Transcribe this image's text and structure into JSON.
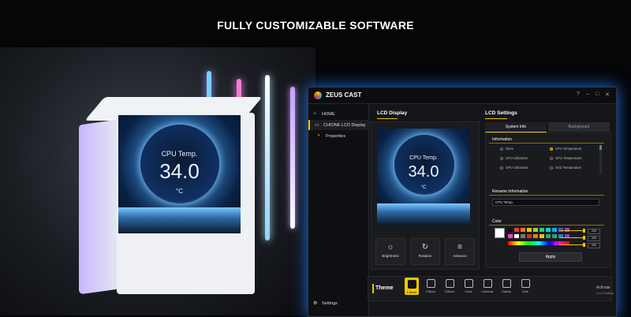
{
  "headline": "FULLY CUSTOMIZABLE SOFTWARE",
  "device_screen": {
    "title": "CPU Temp.",
    "value": "34.0",
    "unit": "°C"
  },
  "app": {
    "name": "ZEUS CAST",
    "window_controls": [
      "?",
      "–",
      "□",
      "✕"
    ],
    "sidebar": {
      "items": [
        {
          "label": "HOME",
          "icon": "home-icon"
        },
        {
          "label": "CHIONE LCD Display",
          "icon": "monitor-icon",
          "active": true
        },
        {
          "label": "Properties",
          "icon": "folder-icon"
        }
      ],
      "settings_label": "Settings"
    },
    "lcd_display": {
      "title": "LCD Display",
      "preview": {
        "title": "CPU Temp.",
        "value": "34.0",
        "unit": "°C"
      },
      "controls": [
        {
          "label": "Brightness",
          "icon": "☼"
        },
        {
          "label": "Rotation",
          "icon": "↻"
        },
        {
          "label": "Advance",
          "icon": "≡"
        }
      ]
    },
    "lcd_settings": {
      "title": "LCD Settings",
      "tabs": [
        {
          "label": "System Info",
          "active": true
        },
        {
          "label": "Background",
          "active": false
        }
      ],
      "information": {
        "title": "Information",
        "options": [
          {
            "label": "None",
            "selected": false
          },
          {
            "label": "CPU Temperature",
            "selected": true
          },
          {
            "label": "CPU Utilization",
            "selected": false
          },
          {
            "label": "GPU Temperature",
            "selected": false
          },
          {
            "label": "GPU Utilization",
            "selected": false
          },
          {
            "label": "SSD Temperature",
            "selected": false
          }
        ]
      },
      "rename": {
        "title": "Rename Information",
        "value": "CPU Temp."
      },
      "color": {
        "title": "Color",
        "current": "#ffffff",
        "palette": [
          "#111111",
          "#e63946",
          "#ff7b00",
          "#f0c400",
          "#9bd13b",
          "#2ecc71",
          "#00d5c8",
          "#00a8ff",
          "#3f51ff",
          "#8e44ff",
          "#ff3fbf",
          "#ffffff",
          "#777777",
          "#c0392b",
          "#e67e22",
          "#f1c40f",
          "#27ae60",
          "#16a085",
          "#2980b9",
          "#8e44ad"
        ],
        "rgb": [
          {
            "label": "R",
            "value": "255",
            "level": 1.0
          },
          {
            "label": "G",
            "value": "255",
            "level": 1.0
          },
          {
            "label": "B",
            "value": "255",
            "level": 1.0
          }
        ]
      },
      "apply_label": "Apply"
    },
    "theme": {
      "title": "Theme",
      "items": [
        {
          "label": "1 Block",
          "active": true
        },
        {
          "label": "2 Block",
          "active": false
        },
        {
          "label": "3 Block",
          "active": false
        },
        {
          "label": "Clock",
          "active": false
        },
        {
          "label": "Calendar",
          "active": false
        },
        {
          "label": "Gallery",
          "active": false
        },
        {
          "label": "Note",
          "active": false
        }
      ]
    },
    "watermark": {
      "line1": "Activate",
      "line2": "Go to Settings"
    }
  }
}
